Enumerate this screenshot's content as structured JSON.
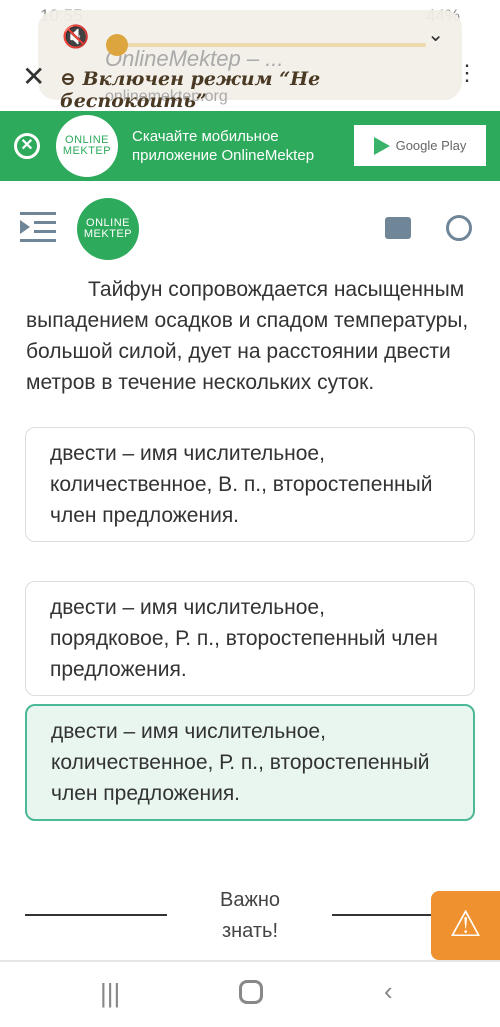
{
  "status": {
    "time": "10:55",
    "battery": "44%"
  },
  "browser": {
    "title": "OnlineMektep – ...",
    "url": "onlinemektep.org"
  },
  "overlay": {
    "dnd_text": "Включен режим “Не беспокоить”"
  },
  "banner": {
    "logo_line1": "ONLINE",
    "logo_line2": "MEKTEP",
    "text_line1": "Скачайте мобильное",
    "text_line2": "приложение OnlineMektep",
    "store_label": "Google Play"
  },
  "header": {
    "logo_line1": "ONLINE",
    "logo_line2": "MEKTEP"
  },
  "question": "Тайфун сопровождается насыщенным выпадением осадков и спадом температуры, большой силой, дует на расстоянии двести метров в течение нескольких суток.",
  "options": [
    {
      "text": "двести – имя числительное, количественное, В. п., второстепенный член предложения.",
      "selected": false
    },
    {
      "text": "двести – имя числительное, порядковое, Р. п., второстепенный член предложения.",
      "selected": false
    },
    {
      "text": "двести – имя числительное, количественное, Р. п., второстепенный член предложения.",
      "selected": true
    }
  ],
  "important": {
    "line1": "Важно",
    "line2": "знать!"
  },
  "colors": {
    "brand_green": "#2eaa5c",
    "warning_orange": "#f0912f",
    "selected_border": "#4bb896"
  }
}
